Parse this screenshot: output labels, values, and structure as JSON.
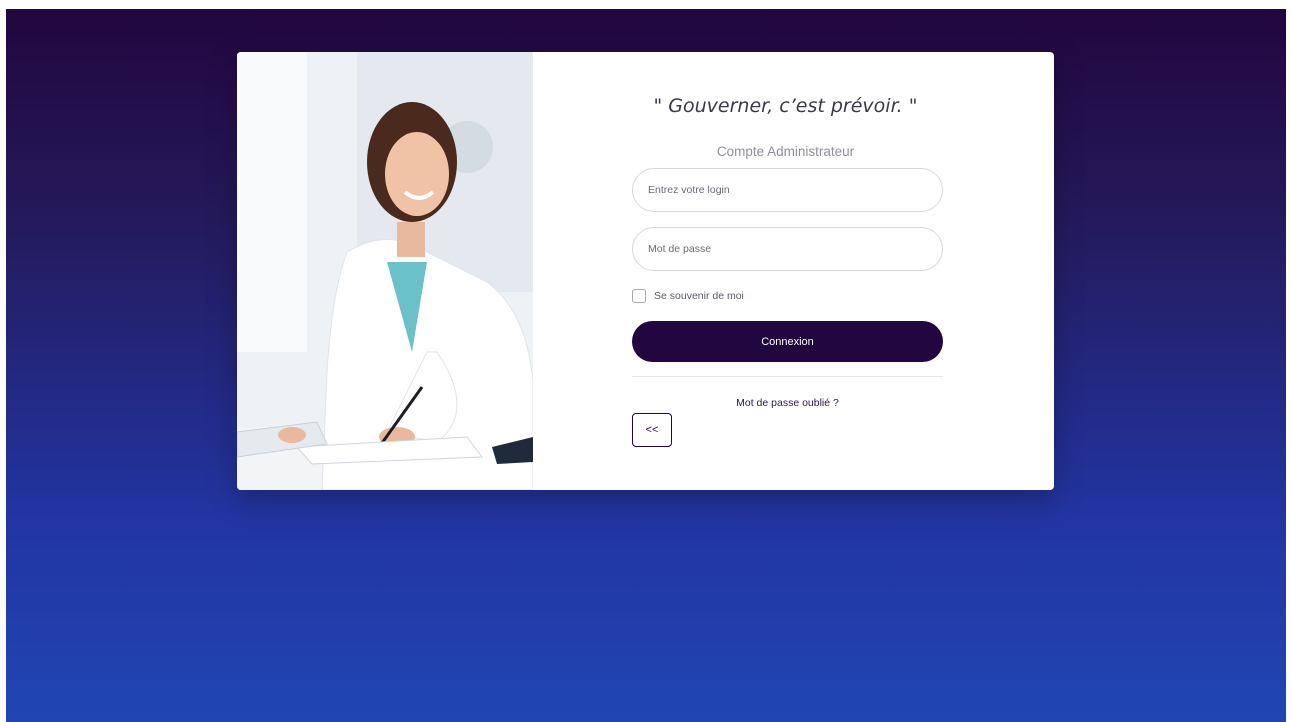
{
  "login": {
    "quote": "\" Gouverner, c’est prévoir. \"",
    "subtitle": "Compte Administrateur",
    "login_placeholder": "Entrez votre login",
    "password_placeholder": "Mot de passe",
    "remember_label": "Se souvenir de moi",
    "submit_label": "Connexion",
    "forgot_link": "Mot de passe oublié ?",
    "back_label": "<<"
  },
  "colors": {
    "primary": "#22063f",
    "background_top": "#22063f",
    "background_bottom": "#2046b4"
  }
}
